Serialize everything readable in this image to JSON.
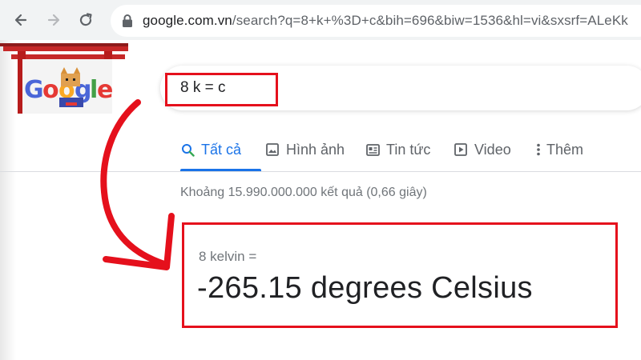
{
  "browser": {
    "url_host": "google.com.vn",
    "url_path": "/search?q=8+k+%3D+c&bih=696&biw=1536&hl=vi&sxsrf=ALeKk",
    "back_icon": "arrow-left-icon",
    "forward_icon": "arrow-right-icon",
    "reload_icon": "reload-icon",
    "lock_icon": "lock-icon"
  },
  "logo": {
    "text": "Google",
    "style": "doodle"
  },
  "search": {
    "query": "8 k = c"
  },
  "tabs": [
    {
      "label": "Tất cả",
      "icon": "search-icon",
      "active": true
    },
    {
      "label": "Hình ảnh",
      "icon": "image-icon",
      "active": false
    },
    {
      "label": "Tin tức",
      "icon": "news-icon",
      "active": false
    },
    {
      "label": "Video",
      "icon": "video-icon",
      "active": false
    },
    {
      "label": "Thêm",
      "icon": "more-vert-icon",
      "active": false
    }
  ],
  "results_stats": "Khoảng 15.990.000.000 kết quả (0,66 giây)",
  "conversion": {
    "from": "8 kelvin =",
    "to": "-265.15 degrees Celsius"
  },
  "colors": {
    "highlight": "#e5101c",
    "active_tab": "#1a73e8",
    "secondary_text": "#70757a"
  }
}
